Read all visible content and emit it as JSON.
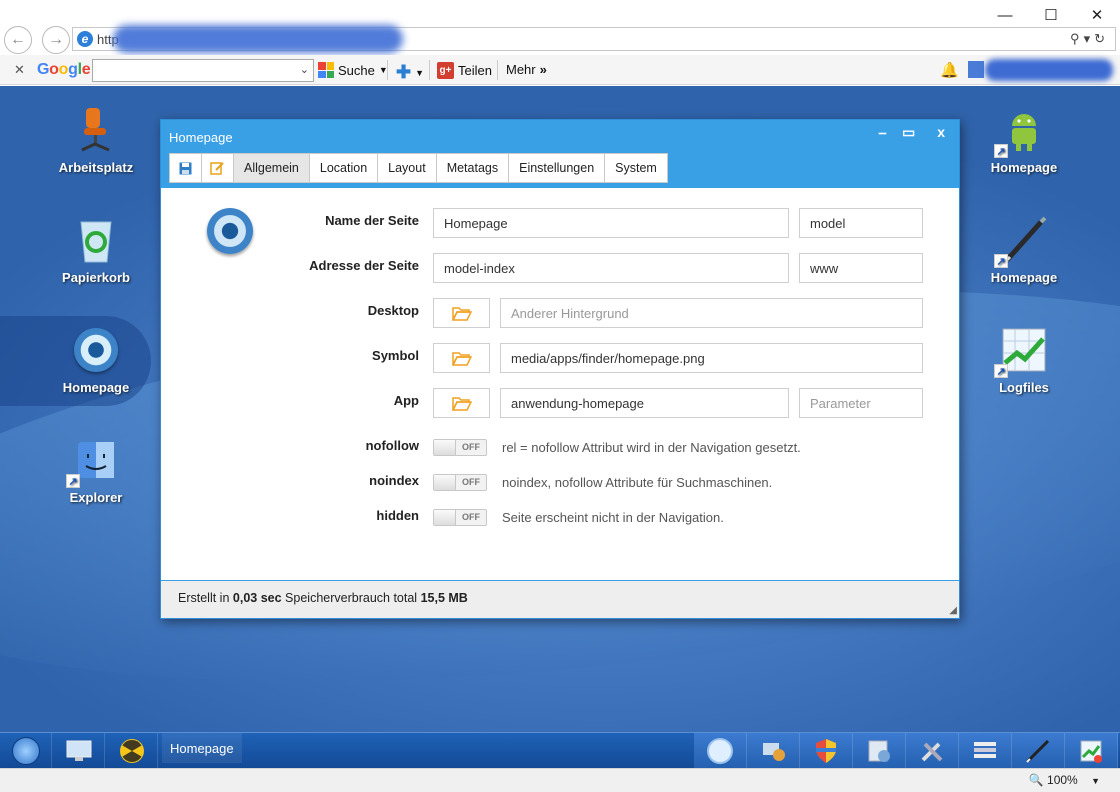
{
  "browser": {
    "url_prefix": "http",
    "search_engine": "Google",
    "search_button": "Suche",
    "share_button": "Teilen",
    "more_button": "Mehr",
    "zoom": "100%"
  },
  "desktop": {
    "left_icons": [
      {
        "label": "Arbeitsplatz",
        "icon": "office-chair-icon"
      },
      {
        "label": "Papierkorb",
        "icon": "recycle-bin-icon"
      },
      {
        "label": "Homepage",
        "icon": "globe-icon"
      },
      {
        "label": "Explorer",
        "icon": "finder-icon"
      }
    ],
    "right_icons": [
      {
        "label": "Homepage",
        "icon": "android-icon"
      },
      {
        "label": "Homepage",
        "icon": "pen-icon"
      },
      {
        "label": "Logfiles",
        "icon": "chart-icon"
      }
    ]
  },
  "window": {
    "title": "Homepage",
    "tabs": [
      "Allgemein",
      "Location",
      "Layout",
      "Metatags",
      "Einstellungen",
      "System"
    ],
    "active_tab": "Allgemein",
    "fields": {
      "name_label": "Name der Seite",
      "name_value": "Homepage",
      "name_model": "model",
      "address_label": "Adresse der Seite",
      "address_value": "model-index",
      "address_prefix": "www",
      "desktop_label": "Desktop",
      "desktop_placeholder": "Anderer Hintergrund",
      "symbol_label": "Symbol",
      "symbol_value": "media/apps/finder/homepage.png",
      "app_label": "App",
      "app_value": "anwendung-homepage",
      "app_param_placeholder": "Parameter"
    },
    "toggles": [
      {
        "label": "nofollow",
        "state": "OFF",
        "description": "rel = nofollow Attribut wird in der Navigation gesetzt."
      },
      {
        "label": "noindex",
        "state": "OFF",
        "description": "noindex, nofollow Attribute für Suchmaschinen."
      },
      {
        "label": "hidden",
        "state": "OFF",
        "description": "Seite erscheint nicht in der Navigation."
      }
    ],
    "status": {
      "prefix": "Erstellt in",
      "time": "0,03 sec",
      "middle": "Speicherverbrauch total",
      "memory": "15,5 MB"
    }
  },
  "taskbar": {
    "task_label": "Homepage"
  },
  "colors": {
    "titlebar": "#3aa0e6",
    "folder_icon": "#f0a020",
    "taskbar": "#1a58a8"
  }
}
